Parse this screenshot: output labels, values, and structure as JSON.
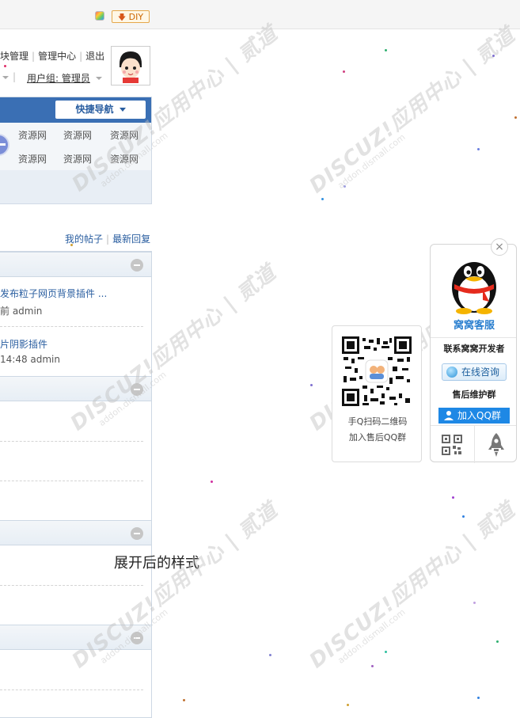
{
  "toolbar": {
    "diy_label": "DIY",
    "diy_arrow": "🡇",
    "color_icon": "palette-icon"
  },
  "user": {
    "links": [
      "块管理",
      "管理中心",
      "退出"
    ],
    "separator": "|",
    "usergroup": "用户组: 管理员"
  },
  "quick_nav": {
    "label": "快捷导航",
    "items": [
      "资源网",
      "资源网",
      "资源网",
      "资源网",
      "资源网",
      "资源网"
    ]
  },
  "post_links": {
    "my_posts": "我的帖子",
    "latest_replies": "最新回复",
    "separator": "|"
  },
  "threads": [
    {
      "title": "发布粒子网页背景插件 ...",
      "meta": "前 admin"
    },
    {
      "title": "片阴影插件",
      "meta": "14:48 admin"
    }
  ],
  "caption": "展开后的样式",
  "watermark": {
    "brand": "DISCUZ!应用中心 | 贰道",
    "url": "addon.dismall.com"
  },
  "qr_popup": {
    "line1": "手Q扫码二维码",
    "line2": "加入售后QQ群"
  },
  "kefu": {
    "close": "×",
    "title": "窝窝客服",
    "contact": "联系窝窝开发者",
    "online": "在线咨询",
    "after_sales": "售后维护群",
    "join_qq": "加入QQ群"
  },
  "colors": {
    "accent": "#3a6fb4",
    "link": "#2a5ea0",
    "qq_button": "#1e88e5",
    "kefu_title": "#2a7fcf"
  }
}
